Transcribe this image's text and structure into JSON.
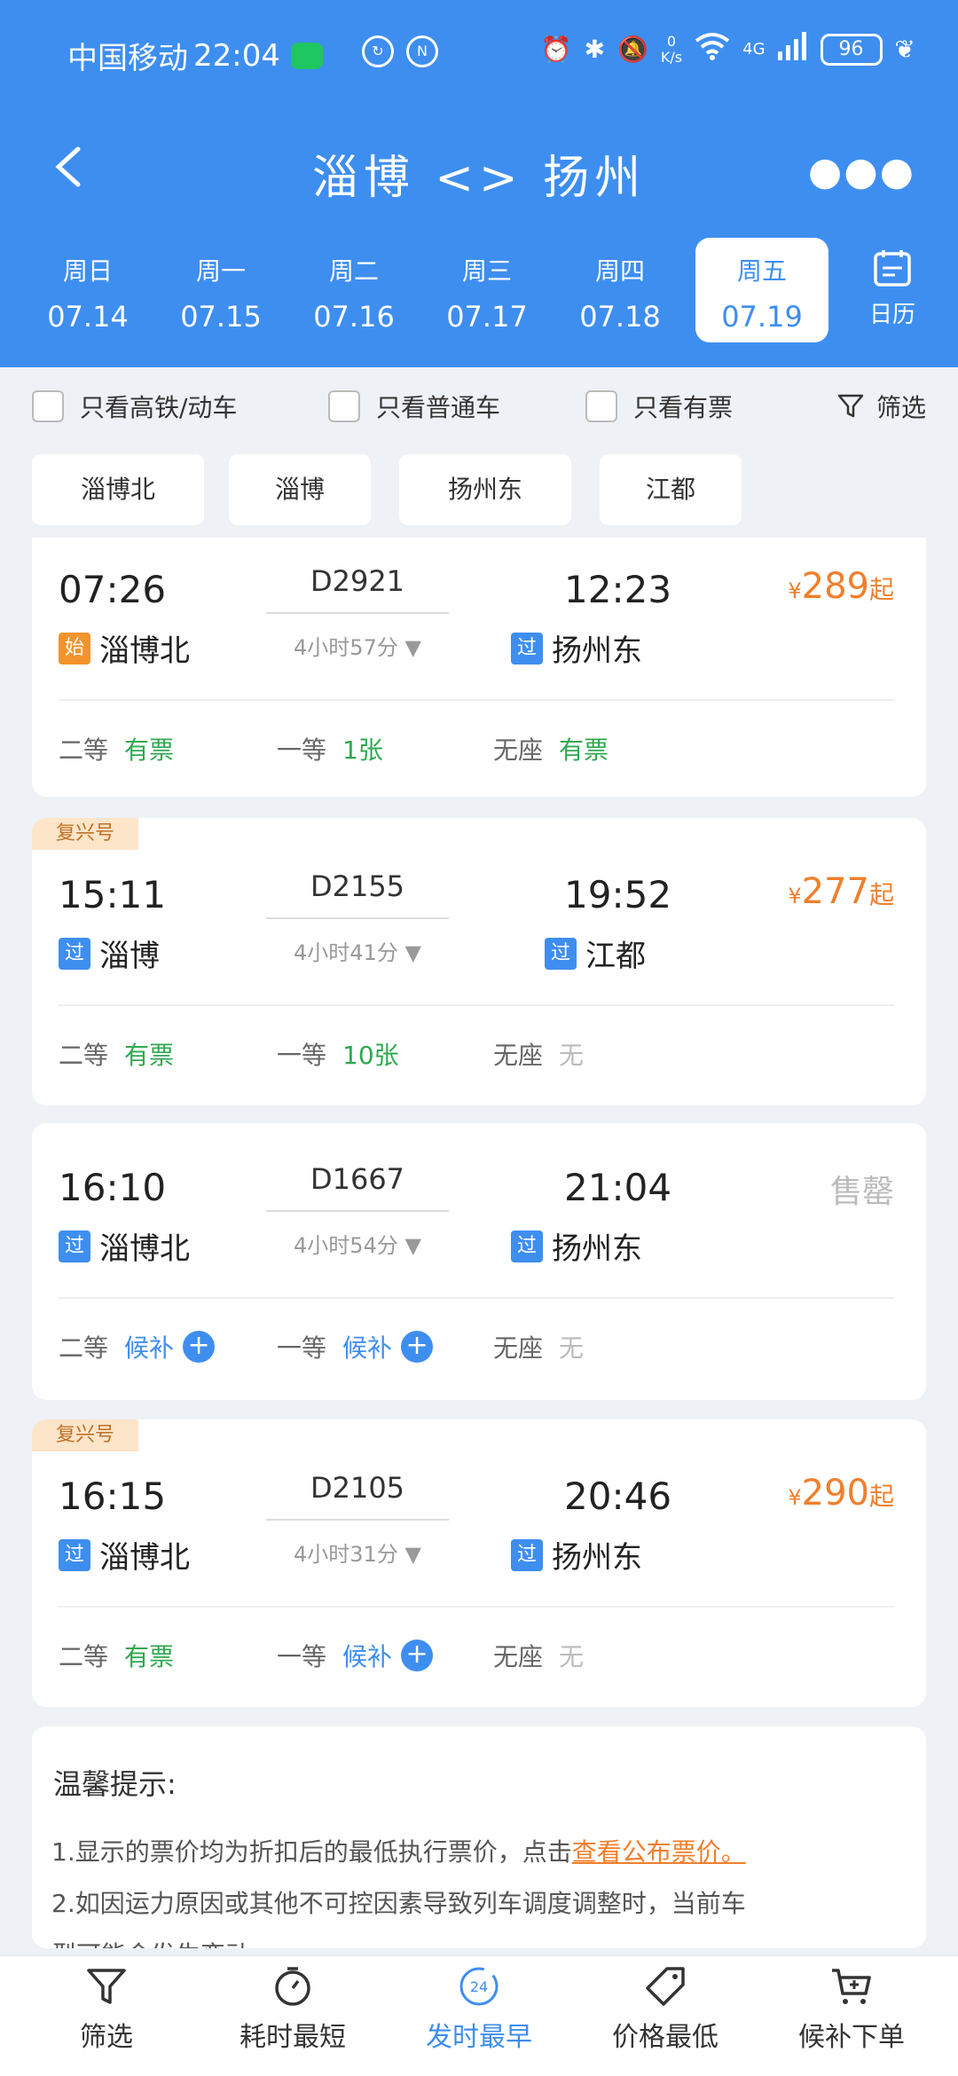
{
  "status_bar": {
    "carrier": "中国移动",
    "time": "22:04",
    "net_speed": "0",
    "net_unit": "K/s",
    "network_type": "4G",
    "battery": "96"
  },
  "header": {
    "title": "淄博 <> 扬州",
    "colors": {
      "primary": "#3e8ef0"
    }
  },
  "dates": [
    {
      "weekday": "周日",
      "date": "07.14"
    },
    {
      "weekday": "周一",
      "date": "07.15"
    },
    {
      "weekday": "周二",
      "date": "07.16"
    },
    {
      "weekday": "周三",
      "date": "07.17"
    },
    {
      "weekday": "周四",
      "date": "07.18"
    },
    {
      "weekday": "周五",
      "date": "07.19",
      "selected": true
    }
  ],
  "calendar_label": "日历",
  "filters": {
    "only_high_speed": "只看高铁/动车",
    "only_regular": "只看普通车",
    "only_available": "只看有票",
    "filter_label": "筛选"
  },
  "stations": [
    "淄博北",
    "淄博",
    "扬州东",
    "江都"
  ],
  "trains": [
    {
      "tag": "",
      "dep_time": "07:26",
      "dep_badge": "始",
      "dep_station": "淄博北",
      "train_no": "D2921",
      "duration": "4小时57分",
      "arr_time": "12:23",
      "arr_badge": "过",
      "arr_station": "扬州东",
      "price_symbol": "¥",
      "price": "289",
      "price_suffix": "起",
      "seats": [
        {
          "class": "二等",
          "status": "有票"
        },
        {
          "class": "一等",
          "status": "1张"
        },
        {
          "class": "无座",
          "status": "有票"
        }
      ]
    },
    {
      "tag": "复兴号",
      "dep_time": "15:11",
      "dep_badge": "过",
      "dep_station": "淄博",
      "train_no": "D2155",
      "duration": "4小时41分",
      "arr_time": "19:52",
      "arr_badge": "过",
      "arr_station": "江都",
      "price_symbol": "¥",
      "price": "277",
      "price_suffix": "起",
      "seats": [
        {
          "class": "二等",
          "status": "有票"
        },
        {
          "class": "一等",
          "status": "10张"
        },
        {
          "class": "无座",
          "status": "无"
        }
      ]
    },
    {
      "tag": "",
      "dep_time": "16:10",
      "dep_badge": "过",
      "dep_station": "淄博北",
      "train_no": "D1667",
      "duration": "4小时54分",
      "arr_time": "21:04",
      "arr_badge": "过",
      "arr_station": "扬州东",
      "soldout": "售罄",
      "seats": [
        {
          "class": "二等",
          "status": "候补"
        },
        {
          "class": "一等",
          "status": "候补"
        },
        {
          "class": "无座",
          "status": "无"
        }
      ]
    },
    {
      "tag": "复兴号",
      "dep_time": "16:15",
      "dep_badge": "过",
      "dep_station": "淄博北",
      "train_no": "D2105",
      "duration": "4小时31分",
      "arr_time": "20:46",
      "arr_badge": "过",
      "arr_station": "扬州东",
      "price_symbol": "¥",
      "price": "290",
      "price_suffix": "起",
      "seats": [
        {
          "class": "二等",
          "status": "有票"
        },
        {
          "class": "一等",
          "status": "候补"
        },
        {
          "class": "无座",
          "status": "无"
        }
      ]
    }
  ],
  "tips": {
    "title": "温馨提示:",
    "line1": "1.显示的票价均为折扣后的最低执行票价，点击",
    "line1_link": "查看公布票价。",
    "line2": "2.如因运力原因或其他不可控因素导致列车调度调整时，当前车",
    "line3": "型可能会发生变动。"
  },
  "bottom_nav": {
    "filter": "筛选",
    "shortest": "耗时最短",
    "earliest": "发时最早",
    "earliest_icon_text": "24",
    "cheapest": "价格最低",
    "waitlist": "候补下单"
  }
}
